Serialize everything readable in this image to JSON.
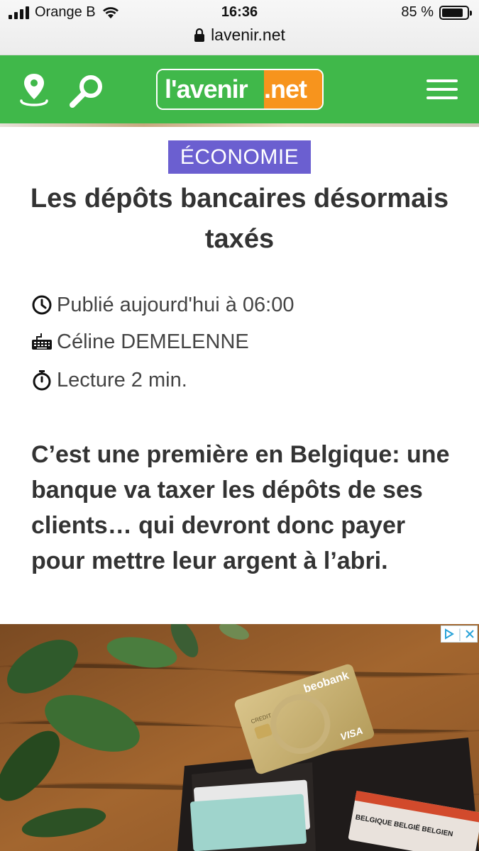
{
  "status_bar": {
    "carrier": "Orange B",
    "time": "16:36",
    "battery": "85 %",
    "battery_level": 0.85,
    "url": "lavenir.net"
  },
  "header": {
    "logo_left": "l'avenir",
    "logo_right": ".net",
    "icons": [
      "location-pin-icon",
      "search-icon",
      "hamburger-menu-icon"
    ],
    "colors": {
      "bar": "#40b84a",
      "logo_accent": "#f7941d"
    }
  },
  "article": {
    "category": "ÉCONOMIE",
    "category_color": "#6b5fd0",
    "title": "Les dépôts bancaires désormais taxés",
    "published": "Publié aujourd'hui à 06:00",
    "author": "Céline DEMELENNE",
    "reading_time": "Lecture 2 min.",
    "lead": "C’est une première en Belgique: une banque va taxer les dépôts de ses clients… qui devront donc payer pour mettre leur argent à l’abri."
  },
  "ad": {
    "card_brand": "beobank",
    "card_type": "CREDIT",
    "card_network": "VISA",
    "id_card_text": "BELGIQUE BELGIË BELGIEN"
  }
}
